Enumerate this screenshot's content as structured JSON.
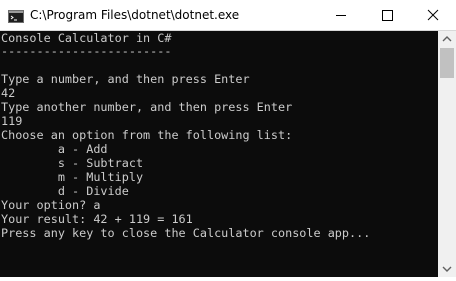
{
  "window": {
    "title": "C:\\Program Files\\dotnet\\dotnet.exe",
    "colors": {
      "console_bg": "#0c0c0c",
      "console_text": "#cccccc",
      "titlebar_bg": "#ffffff"
    }
  },
  "controls": {
    "minimize_icon": "minimize-icon",
    "maximize_icon": "maximize-icon",
    "close_icon": "close-icon"
  },
  "console": {
    "lines": [
      "Console Calculator in C#",
      "------------------------",
      "",
      "Type a number, and then press Enter",
      "42",
      "Type another number, and then press Enter",
      "119",
      "Choose an option from the following list:",
      "        a - Add",
      "        s - Subtract",
      "        m - Multiply",
      "        d - Divide",
      "Your option? a",
      "Your result: 42 + 119 = 161",
      "Press any key to close the Calculator console app..."
    ]
  }
}
